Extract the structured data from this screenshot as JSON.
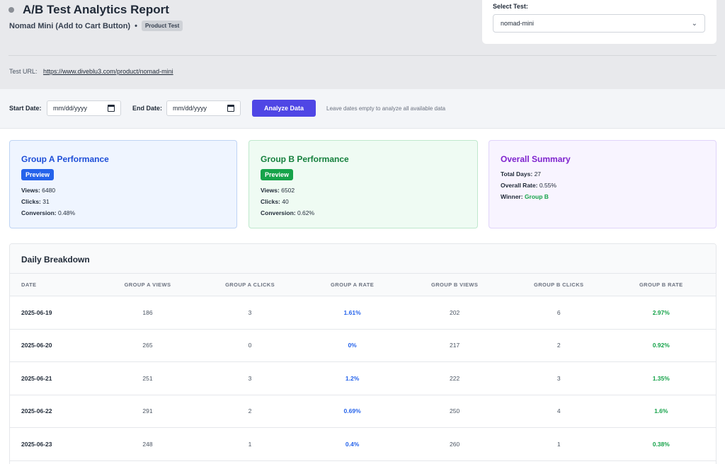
{
  "header": {
    "title": "A/B Test Analytics Report",
    "subtitle": "Nomad Mini (Add to Cart Button)",
    "bullet": "•",
    "badge": "Product Test",
    "url_label": "Test URL:",
    "url": "https://www.diveblu3.com/product/nomad-mini"
  },
  "test_select": {
    "label": "Select Test:",
    "value": "nomad-mini"
  },
  "filters": {
    "start_label": "Start Date:",
    "start_placeholder": "mm/dd/yyyy",
    "end_label": "End Date:",
    "end_placeholder": "mm/dd/yyyy",
    "analyze_label": "Analyze Data",
    "hint": "Leave dates empty to analyze all available data"
  },
  "group_a": {
    "title": "Group A Performance",
    "badge": "Preview",
    "views_label": "Views:",
    "views": "6480",
    "clicks_label": "Clicks:",
    "clicks": "31",
    "conversion_label": "Conversion:",
    "conversion": "0.48%"
  },
  "group_b": {
    "title": "Group B Performance",
    "badge": "Preview",
    "views_label": "Views:",
    "views": "6502",
    "clicks_label": "Clicks:",
    "clicks": "40",
    "conversion_label": "Conversion:",
    "conversion": "0.62%"
  },
  "summary": {
    "title": "Overall Summary",
    "days_label": "Total Days:",
    "days": "27",
    "rate_label": "Overall Rate:",
    "rate": "0.55%",
    "winner_label": "Winner:",
    "winner": "Group B"
  },
  "table": {
    "title": "Daily Breakdown",
    "columns": [
      "DATE",
      "GROUP A VIEWS",
      "GROUP A CLICKS",
      "GROUP A RATE",
      "GROUP B VIEWS",
      "GROUP B CLICKS",
      "GROUP B RATE"
    ],
    "rows": [
      [
        "2025-06-19",
        "186",
        "3",
        "1.61%",
        "202",
        "6",
        "2.97%"
      ],
      [
        "2025-06-20",
        "265",
        "0",
        "0%",
        "217",
        "2",
        "0.92%"
      ],
      [
        "2025-06-21",
        "251",
        "3",
        "1.2%",
        "222",
        "3",
        "1.35%"
      ],
      [
        "2025-06-22",
        "291",
        "2",
        "0.69%",
        "250",
        "4",
        "1.6%"
      ],
      [
        "2025-06-23",
        "248",
        "1",
        "0.4%",
        "260",
        "1",
        "0.38%"
      ]
    ]
  },
  "colors": {
    "accent": "#4f46e5",
    "group_a": "#2563eb",
    "group_b": "#16a34a",
    "summary": "#7e22ce"
  }
}
